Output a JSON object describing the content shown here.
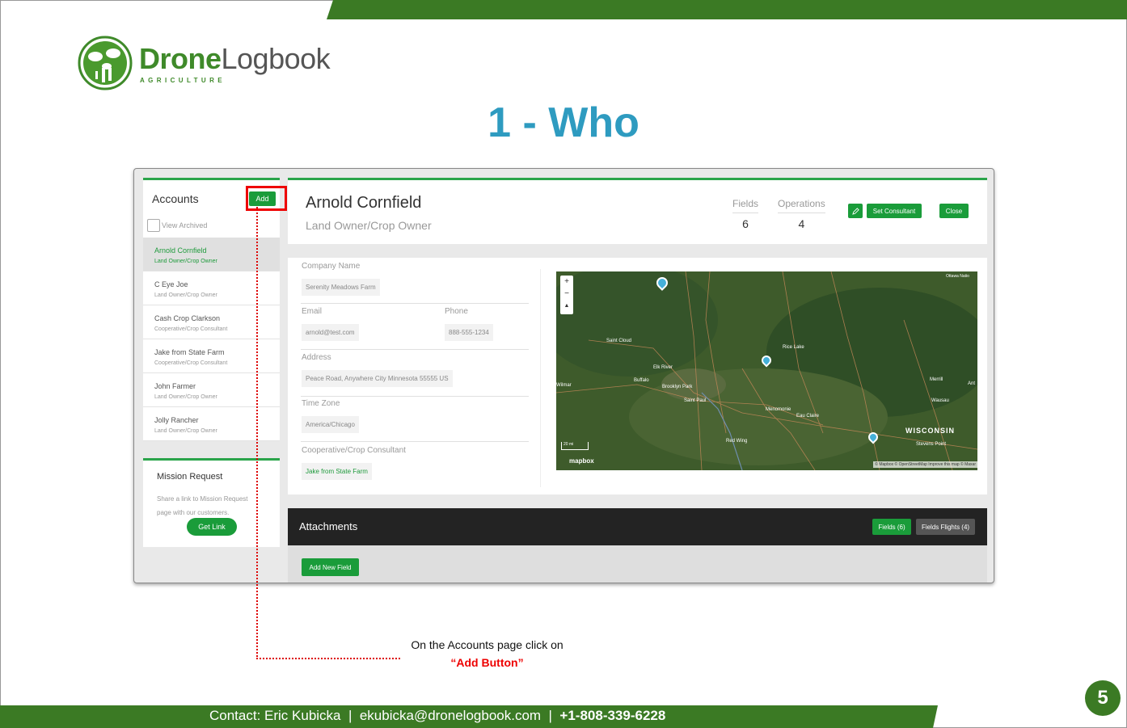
{
  "slide": {
    "title": "1 - Who",
    "page_number": "5",
    "contact": {
      "prefix": "Contact: Eric Kubicka",
      "email": "ekubicka@dronelogbook.com",
      "phone": "+1-808-339-6228",
      "separator": "|"
    },
    "logo": {
      "word_bold": "Drone",
      "word_light": "Logbook",
      "subtitle": "AGRICULTURE"
    },
    "note": {
      "line1": "On the Accounts page click on",
      "line2": "“Add Button”"
    },
    "colors": {
      "brand_green": "#3b7a24",
      "title_blue": "#2e9bc0",
      "highlight_red": "#e00000",
      "button_green": "#1a9c3a"
    }
  },
  "accounts": {
    "title": "Accounts",
    "add_label": "Add",
    "view_archived": "View Archived",
    "items": [
      {
        "name": "Arnold Cornfield",
        "role": "Land Owner/Crop Owner",
        "active": true
      },
      {
        "name": "C Eye Joe",
        "role": "Land Owner/Crop Owner"
      },
      {
        "name": "Cash Crop Clarkson",
        "role": "Cooperative/Crop Consultant"
      },
      {
        "name": "Jake from State Farm",
        "role": "Cooperative/Crop Consultant"
      },
      {
        "name": "John Farmer",
        "role": "Land Owner/Crop Owner"
      },
      {
        "name": "Jolly Rancher",
        "role": "Land Owner/Crop Owner"
      }
    ]
  },
  "mission": {
    "title": "Mission Request",
    "text": "Share a link to Mission Request page with our customers.",
    "button": "Get Link"
  },
  "account": {
    "name": "Arnold Cornfield",
    "role": "Land Owner/Crop Owner",
    "fields_label": "Fields",
    "fields_value": "6",
    "operations_label": "Operations",
    "operations_value": "4",
    "edit_icon": "pencil-icon",
    "set_consultant": "Set Consultant",
    "close": "Close"
  },
  "details": {
    "company_label": "Company Name",
    "company_value": "Serenity Meadows Farm",
    "email_label": "Email",
    "email_value": "arnold@test.com",
    "phone_label": "Phone",
    "phone_value": "888-555-1234",
    "address_label": "Address",
    "address_value": "Peace Road, Anywhere City Minnesota 55555 US",
    "timezone_label": "Time Zone",
    "timezone_value": "America/Chicago",
    "consultant_label": "Cooperative/Crop Consultant",
    "consultant_value": "Jake from State Farm"
  },
  "map": {
    "labels": [
      "Saint Cloud",
      "Elk River",
      "Buffalo",
      "Brooklyn Park",
      "Saint Paul",
      "Menomonie",
      "Eau Claire",
      "Red Wing",
      "Rice Lake",
      "WISCONSIN",
      "Stevens Point",
      "Merrill",
      "Wausau",
      "Ottawa Natio",
      "Wilmar",
      "Ant"
    ],
    "scale": "20 mi",
    "brand": "mapbox",
    "attribution": "© Mapbox © OpenStreetMap  Improve this map © Maxar",
    "zoom_in": "+",
    "zoom_out": "−"
  },
  "attachments": {
    "title": "Attachments",
    "fields_tab": "Fields (6)",
    "flights_tab": "Fields Flights (4)",
    "add_field": "Add New Field"
  }
}
